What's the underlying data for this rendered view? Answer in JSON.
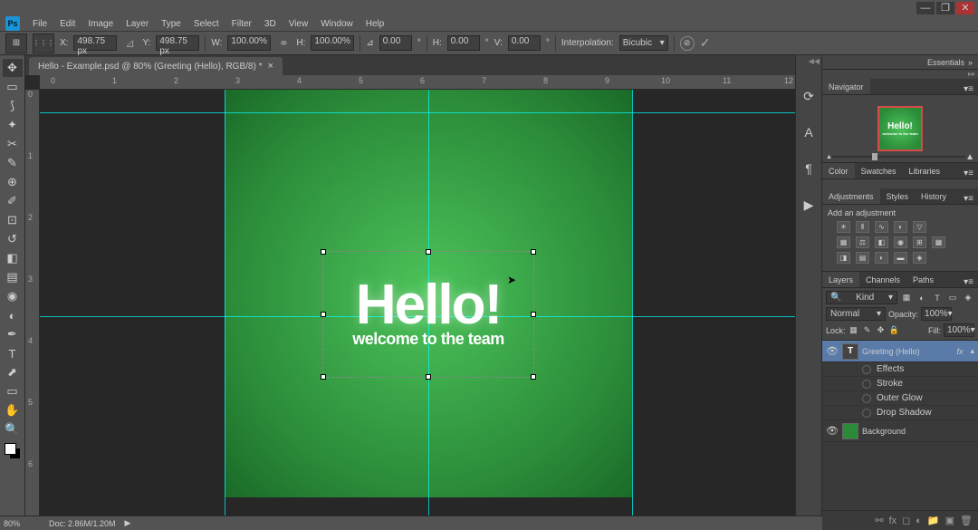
{
  "window": {
    "minimize": "—",
    "maximize": "❐",
    "close": "✕"
  },
  "menu": [
    "File",
    "Edit",
    "Image",
    "Layer",
    "Type",
    "Select",
    "Filter",
    "3D",
    "View",
    "Window",
    "Help"
  ],
  "options": {
    "x_label": "X:",
    "x": "498.75 px",
    "y_label": "Y:",
    "y": "498.75 px",
    "w_label": "W:",
    "w": "100.00%",
    "h_label": "H:",
    "h": "100.00%",
    "angle_label": "⊿",
    "angle": "0.00",
    "deg": "°",
    "skew_h_label": "H:",
    "skew_h": "0.00",
    "skew_deg": "°",
    "skew_v_label": "V:",
    "skew_v": "0.00",
    "interp_label": "Interpolation:",
    "interp": "Bicubic"
  },
  "doctab": {
    "title": "Hello - Example.psd @ 80% (Greeting (Hello), RGB/8) *",
    "close": "×"
  },
  "ruler_h": [
    "0",
    "1",
    "2",
    "3",
    "4",
    "5",
    "6",
    "7",
    "8",
    "9",
    "10",
    "11",
    "12"
  ],
  "ruler_v": [
    "0",
    "1",
    "2",
    "3",
    "4",
    "5",
    "6"
  ],
  "canvas": {
    "hello": "Hello!",
    "subtitle": "welcome to the team"
  },
  "essentials": {
    "label": "Essentials",
    "arrow": "»"
  },
  "navigator_tab": "Navigator",
  "nav_thumb": {
    "t1": "Hello!",
    "t2": "welcome to the team"
  },
  "color_tabs": [
    "Color",
    "Swatches",
    "Libraries"
  ],
  "adjust_tabs": [
    "Adjustments",
    "Styles",
    "History"
  ],
  "adjust_title": "Add an adjustment",
  "layers_tabs": [
    "Layers",
    "Channels",
    "Paths"
  ],
  "layers_opts": {
    "kind": "Kind",
    "blend": "Normal",
    "opacity_label": "Opacity:",
    "opacity": "100%",
    "lock_label": "Lock:",
    "fill_label": "Fill:",
    "fill": "100%"
  },
  "layers": [
    {
      "name": "Greeting (Hello)",
      "type": "text",
      "fx": "fx",
      "selected": true,
      "eye": "👁"
    },
    {
      "name": "Background",
      "type": "bg",
      "selected": false,
      "eye": "👁"
    }
  ],
  "effects_label": "Effects",
  "effects": [
    "Stroke",
    "Outer Glow",
    "Drop Shadow"
  ],
  "status": {
    "zoom": "80%",
    "info": "Doc: 2.86M/1.20M",
    "arrow": "▶"
  }
}
